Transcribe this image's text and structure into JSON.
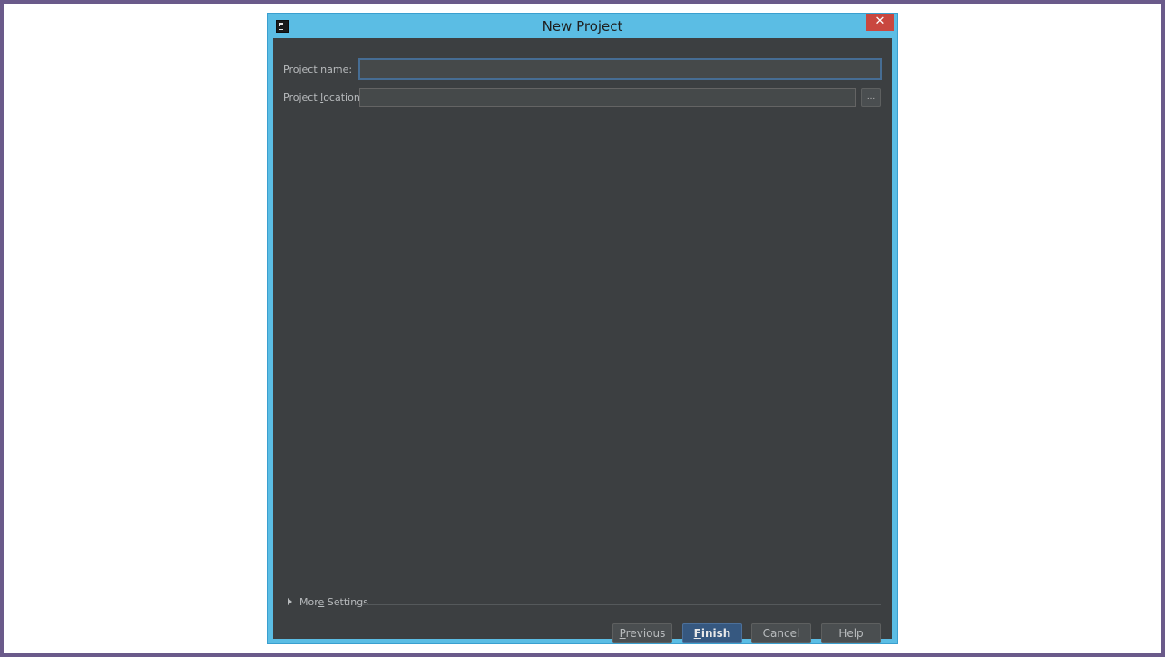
{
  "window": {
    "title": "New Project",
    "close_glyph": "✕"
  },
  "form": {
    "project_name": {
      "label_pre": "Project n",
      "label_mnemonic": "a",
      "label_post": "me:",
      "value": ""
    },
    "project_location": {
      "label_pre": "Project ",
      "label_mnemonic": "l",
      "label_post": "ocation:",
      "value": "",
      "browse_label": "..."
    }
  },
  "more_settings": {
    "label_pre": "Mor",
    "label_mnemonic": "e",
    "label_post": " Settings"
  },
  "buttons": {
    "previous": {
      "mnemonic": "P",
      "rest": "revious"
    },
    "finish": {
      "mnemonic": "F",
      "rest": "inish"
    },
    "cancel": "Cancel",
    "help": "Help"
  },
  "colors": {
    "window_frame": "#5bbde4",
    "dialog_background": "#3c3f41",
    "close_button": "#c9473f",
    "primary_button": "#365880",
    "focus_border": "#466d94"
  }
}
